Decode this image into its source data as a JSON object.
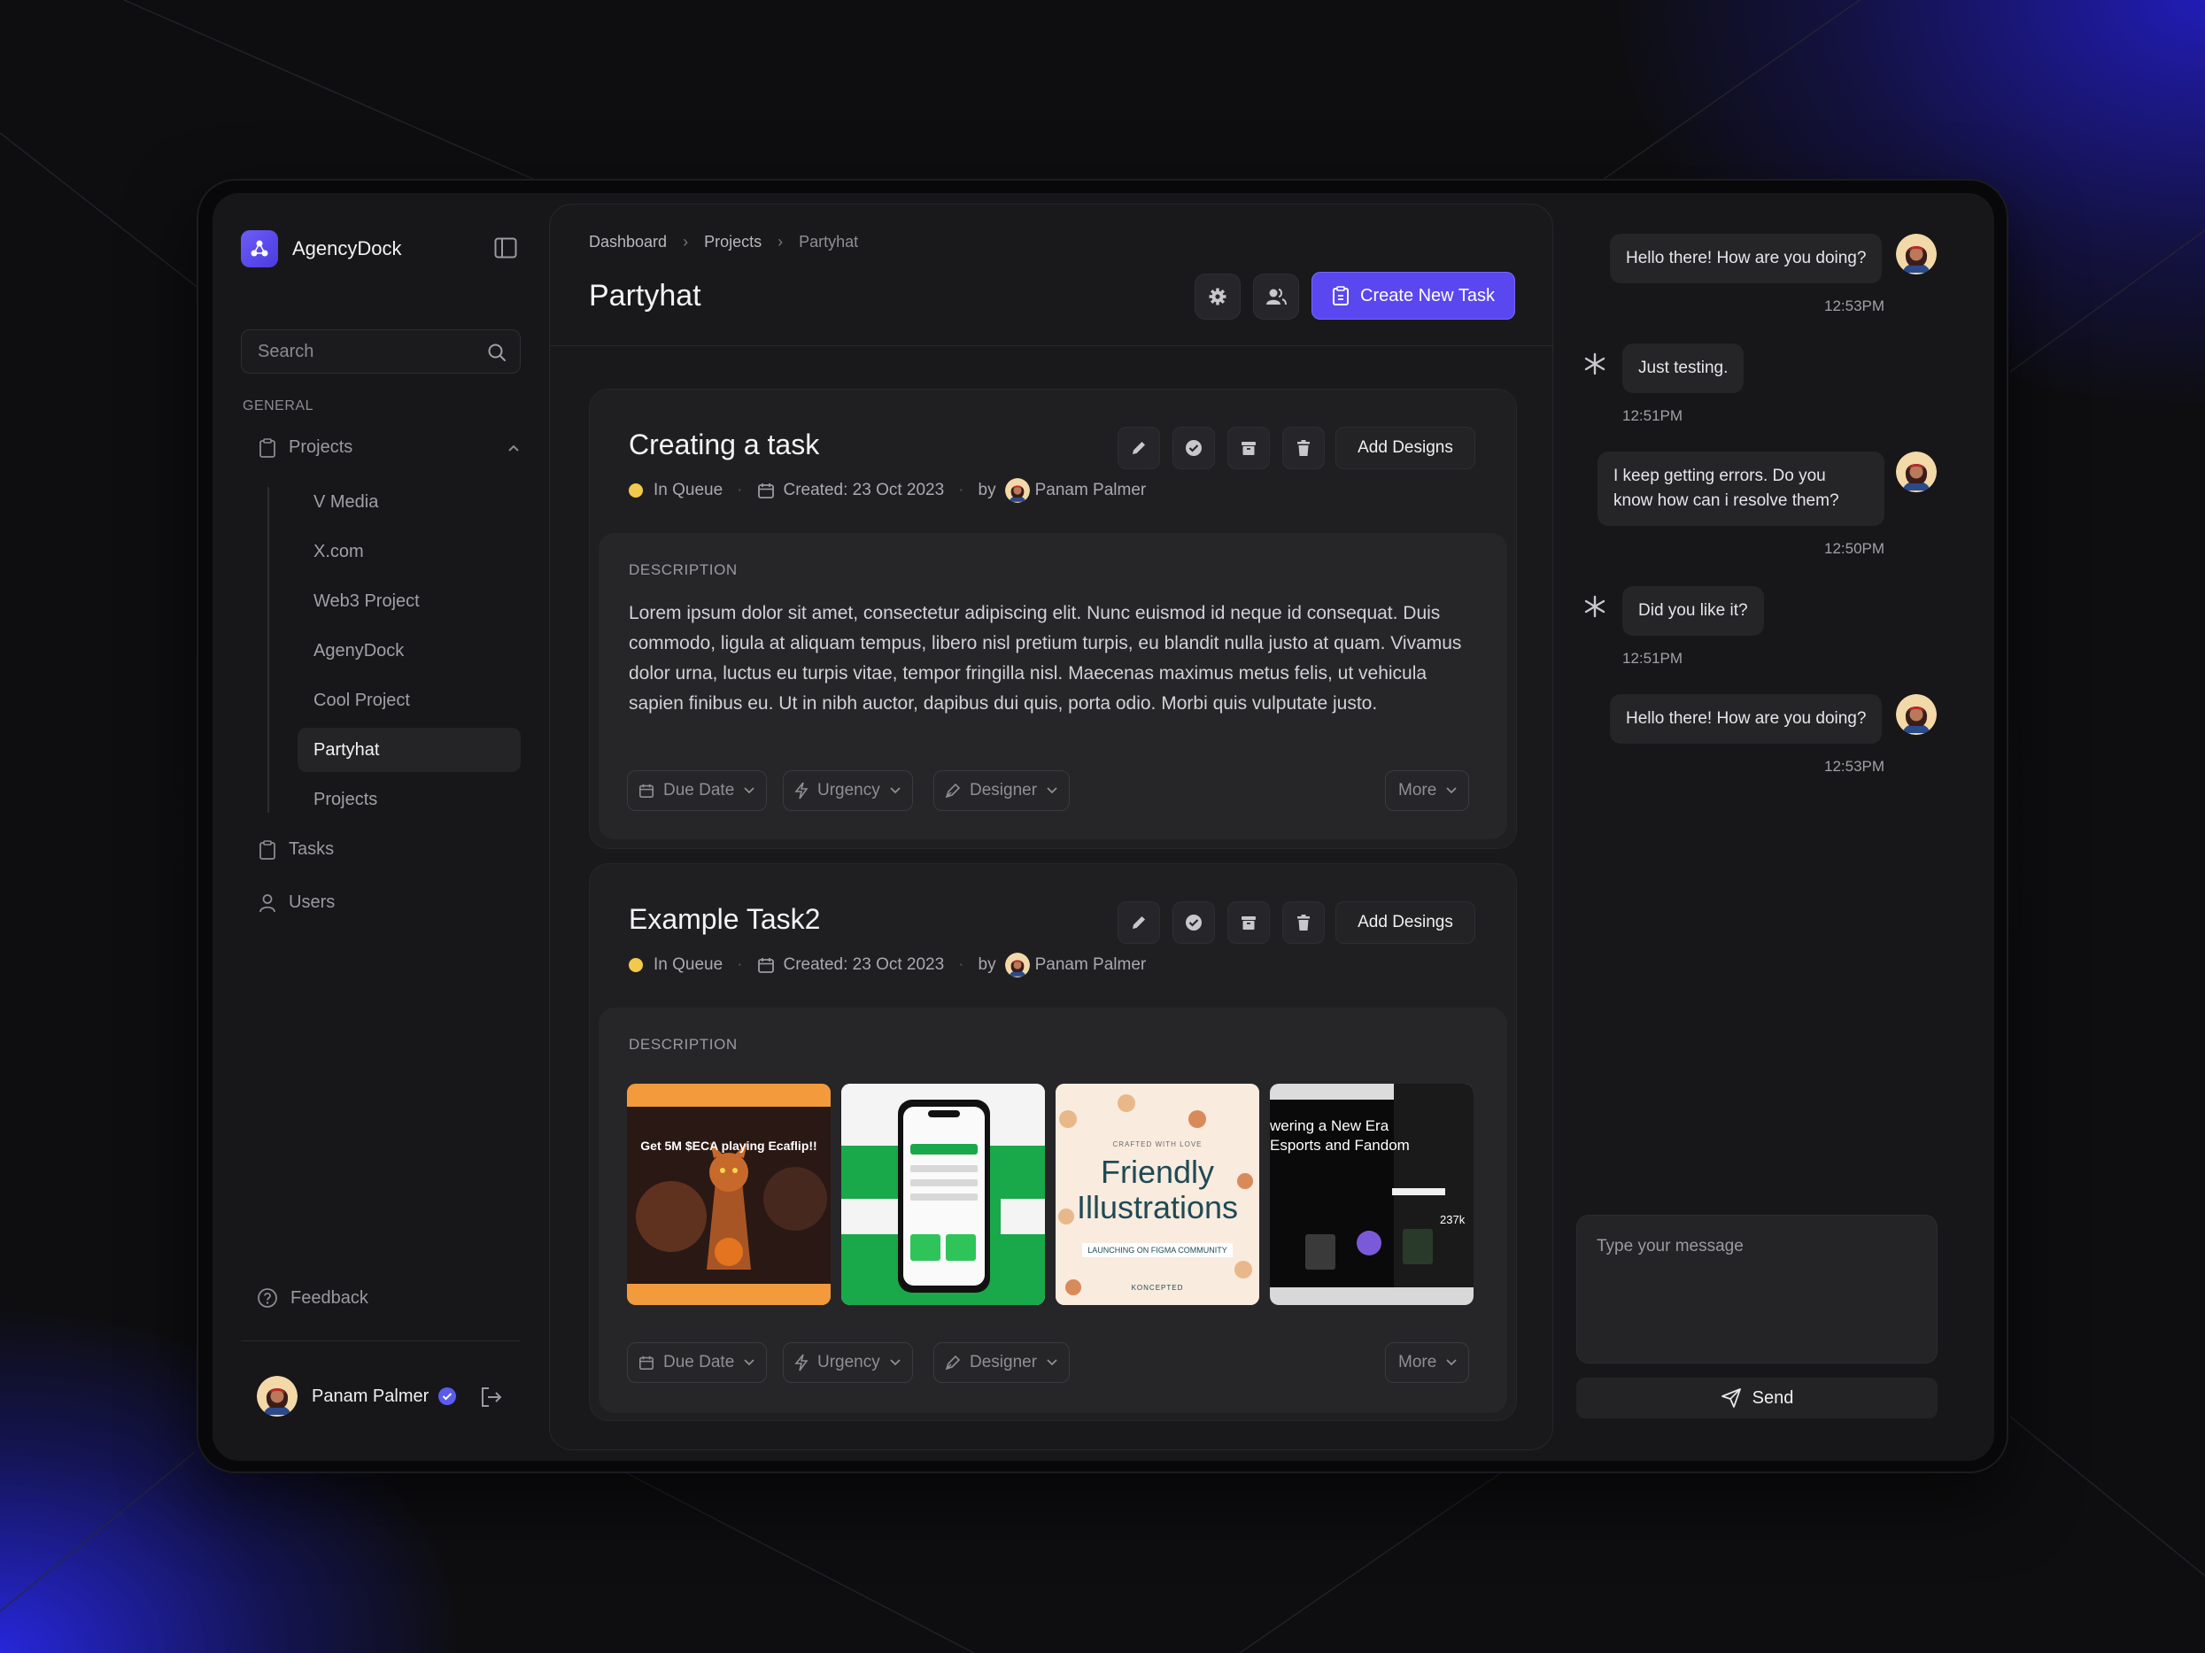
{
  "app": {
    "name": "AgencyDock"
  },
  "search": {
    "placeholder": "Search"
  },
  "sidebar": {
    "section_label": "GENERAL",
    "projects_label": "Projects",
    "sub_items": [
      "V Media",
      "X.com",
      "Web3 Project",
      "AgenyDock",
      "Cool Project",
      "Partyhat",
      "Projects"
    ],
    "active_sub_item": "Partyhat",
    "tasks_label": "Tasks",
    "users_label": "Users",
    "feedback_label": "Feedback",
    "user_name": "Panam Palmer"
  },
  "header": {
    "breadcrumb": [
      "Dashboard",
      "Projects",
      "Partyhat"
    ],
    "title": "Partyhat",
    "create_label": "Create New Task"
  },
  "tasks": [
    {
      "title": "Creating a task",
      "status": "In Queue",
      "created": "Created: 23 Oct 2023",
      "by": "by",
      "author": "Panam Palmer",
      "add_label": "Add Designs",
      "desc_label": "DESCRIPTION",
      "description": "Lorem ipsum dolor sit amet, consectetur adipiscing elit. Nunc euismod id neque id consequat. Duis commodo, ligula at aliquam tempus, libero nisl pretium turpis, eu blandit nulla justo at quam. Vivamus dolor urna, luctus eu turpis vitae, tempor fringilla nisl. Maecenas maximus metus felis, ut vehicula sapien finibus eu. Ut in nibh auctor, dapibus dui quis, porta odio. Morbi quis vulputate justo.",
      "chips": [
        "Due Date",
        "Urgency",
        "Designer"
      ],
      "more_label": "More"
    },
    {
      "title": "Example Task2",
      "status": "In Queue",
      "created": "Created: 23 Oct 2023",
      "by": "by",
      "author": "Panam Palmer",
      "add_label": "Add Desings",
      "desc_label": "DESCRIPTION",
      "thumbnails": [
        {
          "name": "ecaflip-thumbnail",
          "headline": "Get 5M $ECA playing Ecaflip!!"
        },
        {
          "name": "wallet-app-thumbnail"
        },
        {
          "name": "friendly-illustrations-thumbnail",
          "caption": "CRAFTED WITH LOVE",
          "headline_1": "Friendly",
          "headline_2": "Illustrations",
          "footer": "LAUNCHING ON FIGMA COMMUNITY",
          "brand": "KONCEPTED"
        },
        {
          "name": "esports-thumbnail",
          "headline_1": "wering a New Era",
          "headline_2": "Esports and Fandom",
          "stat": "237k"
        }
      ],
      "chips": [
        "Due Date",
        "Urgency",
        "Designer"
      ],
      "more_label": "More"
    }
  ],
  "chat": {
    "messages": [
      {
        "from": "user",
        "text": "Hello there! How are you doing?",
        "time": "12:53PM"
      },
      {
        "from": "bot",
        "text": "Just testing.",
        "time": "12:51PM"
      },
      {
        "from": "user",
        "text": "I keep getting errors. Do you know how can i resolve them?",
        "time": "12:50PM"
      },
      {
        "from": "bot",
        "text": "Did you like it?",
        "time": "12:51PM"
      },
      {
        "from": "user",
        "text": "Hello there! How are you doing?",
        "time": "12:53PM"
      }
    ],
    "input_placeholder": "Type your message",
    "send_label": "Send"
  },
  "colors": {
    "accent": "#5a47ef",
    "status_queue": "#f2c94c",
    "verified": "#5a5cf0"
  }
}
